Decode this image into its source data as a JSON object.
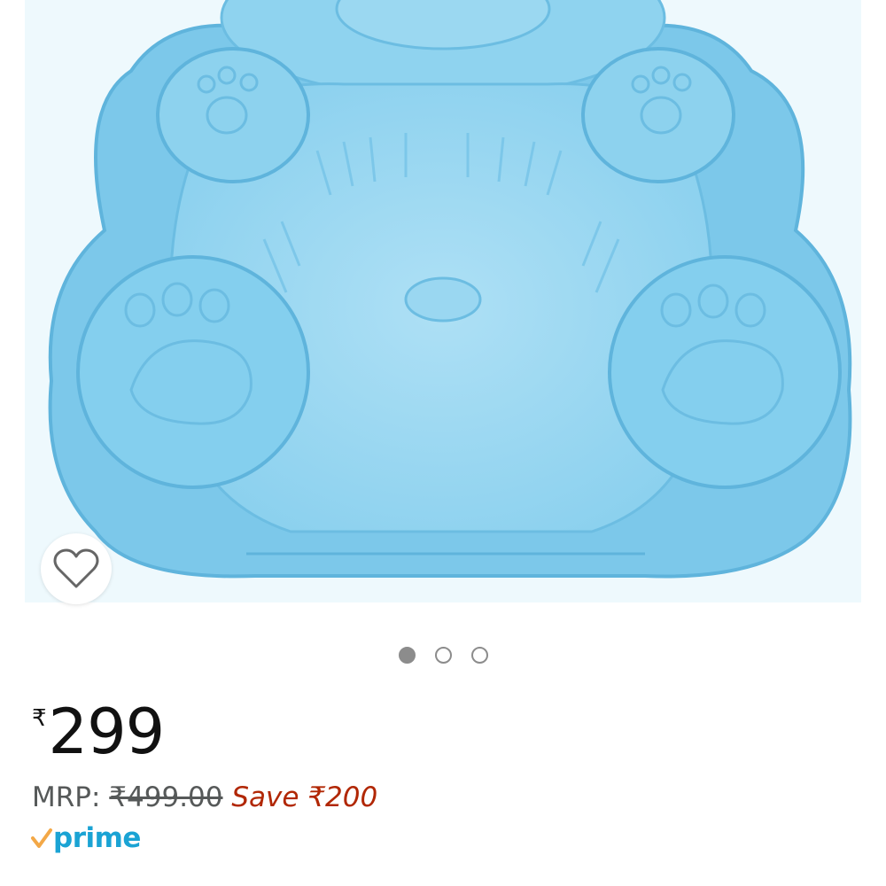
{
  "product_image": {
    "alt": "blue silicone teddy bear cake mould",
    "color": "#7ccbec"
  },
  "wishlist": {
    "icon": "heart-outline-icon"
  },
  "carousel": {
    "total": 3,
    "active_index": 0
  },
  "price": {
    "currency_symbol": "₹",
    "amount": "299"
  },
  "mrp": {
    "label": "MRP:",
    "value": "₹499.00",
    "save_text": "Save ₹200"
  },
  "badge": {
    "text": "prime",
    "icon": "prime-check-icon",
    "check_color": "#f3a847",
    "text_color": "#1aa3d4"
  }
}
